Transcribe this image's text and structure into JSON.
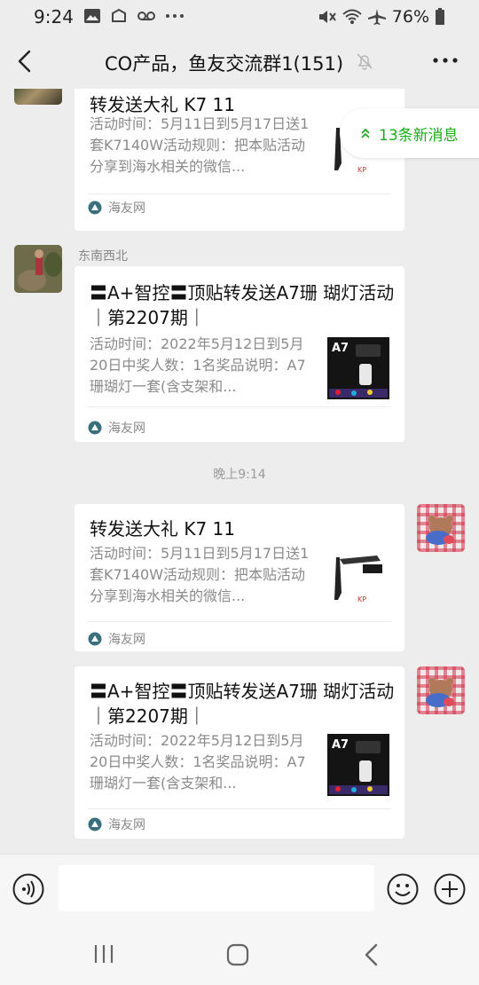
{
  "status_bar": {
    "time": "9:24",
    "battery": "76%",
    "icons_left": [
      "gallery-icon",
      "cast-icon",
      "voicemail-icon",
      "more-dots-icon"
    ],
    "icons_right": [
      "mute-icon",
      "wifi-icon",
      "airplane-icon",
      "battery-icon"
    ]
  },
  "header": {
    "title": "CO产品，鱼友交流群1(151)"
  },
  "new_messages_pill": {
    "label": "13条新消息",
    "color": "#1aad19"
  },
  "messages": [
    {
      "sender": "",
      "outgoing": false,
      "avatar": "avatar-nature",
      "title": "转发送大礼 K7 11",
      "description": "活动时间：5月11日到5月17日送1套K7140W活动规则：把本贴活动分享到海水相关的微信...",
      "thumbnail": "lamp-k7-icon",
      "source": "海友网"
    },
    {
      "sender": "东南西北",
      "outgoing": false,
      "avatar": "avatar-nature",
      "title": "〓A+智控〓顶贴转发送A7珊 瑚灯活动｜第2207期｜",
      "description": "活动时间：2022年5月12日到5月20日中奖人数：1名奖品说明：A7珊瑚灯一套(含支架和...",
      "thumbnail": "a7-poster-icon",
      "thumbnail_label": "A7",
      "source": "海友网"
    },
    {
      "sender": "",
      "outgoing": true,
      "avatar": "avatar-bear",
      "title": "转发送大礼 K7 11",
      "description": "活动时间：5月11日到5月17日送1套K7140W活动规则：把本贴活动分享到海水相关的微信...",
      "thumbnail": "lamp-k7-icon",
      "source": "海友网"
    },
    {
      "sender": "",
      "outgoing": true,
      "avatar": "avatar-bear",
      "title": "〓A+智控〓顶贴转发送A7珊 瑚灯活动｜第2207期｜",
      "description": "活动时间：2022年5月12日到5月20日中奖人数：1名奖品说明：A7珊瑚灯一套(含支架和...",
      "thumbnail": "a7-poster-icon",
      "thumbnail_label": "A7",
      "source": "海友网"
    }
  ],
  "time_separator": "晚上9:14",
  "input_bar": {
    "value": "",
    "buttons": [
      "voice-icon",
      "emoji-icon",
      "plus-icon"
    ]
  },
  "colors": {
    "background": "#ededed",
    "card": "#ffffff",
    "accent_green": "#1aad19"
  }
}
